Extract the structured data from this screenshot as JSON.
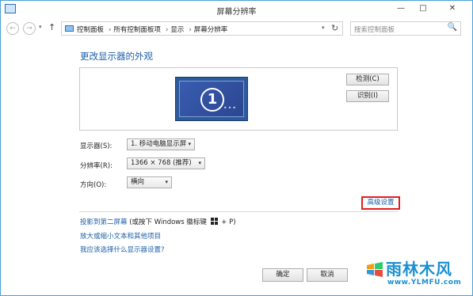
{
  "window": {
    "title": "屏幕分辨率",
    "minimize": "—",
    "maximize": "□",
    "close": "✕"
  },
  "nav": {
    "back": "←",
    "forward": "→",
    "dropdown": "▾",
    "up": "↑"
  },
  "breadcrumbs": [
    "控制面板",
    "所有控制面板项",
    "显示",
    "屏幕分辨率"
  ],
  "breadcrumb_sep": "›",
  "address": {
    "dropdown": "▾",
    "refresh": "↻"
  },
  "search": {
    "placeholder": "搜索控制面板",
    "icon": "🔍"
  },
  "heading": "更改显示器的外观",
  "monitor": {
    "number": "1",
    "dots": "•••"
  },
  "preview_buttons": {
    "detect": "检测(C)",
    "identify": "识别(I)"
  },
  "fields": {
    "display_label": "显示器(S):",
    "display_value": "1. 移动电脑显示屏",
    "resolution_label": "分辨率(R):",
    "resolution_value": "1366 × 768 (推荐)",
    "orientation_label": "方向(O):",
    "orientation_value": "横向",
    "arrow": "▾"
  },
  "advanced_link": "高级设置",
  "links": {
    "project": "投影到第二屏幕",
    "project_hint_before": " (或按下 Windows 徽标键 ",
    "project_hint_after": " + P)",
    "enlarge": "放大或缩小文本和其他项目",
    "which": "我应该选择什么显示器设置?"
  },
  "footer": {
    "ok": "确定",
    "cancel": "取消"
  },
  "watermark": {
    "text": "雨林木风",
    "url": "www.YLMFU.com"
  },
  "colors": {
    "link": "#1d5fa8",
    "highlight_border": "#e02020",
    "window_border": "#4a9fd5"
  }
}
